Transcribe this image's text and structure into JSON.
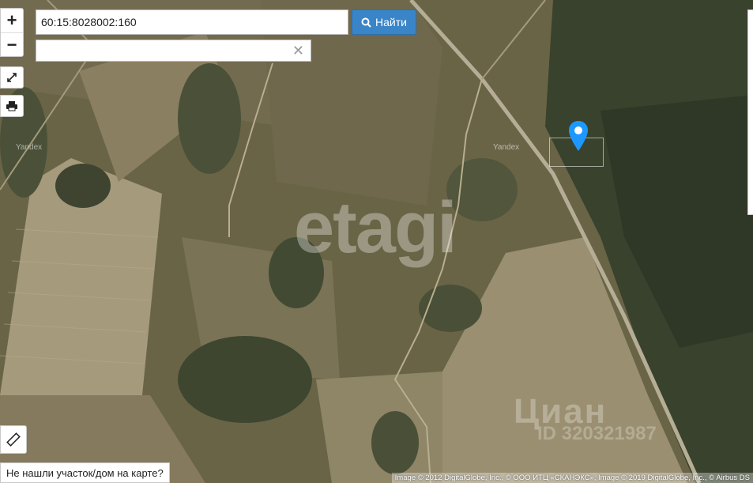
{
  "search": {
    "value": "60:15:8028002:160",
    "button_label": "Найти",
    "second_value": ""
  },
  "map": {
    "watermark": "etagi",
    "tile_labels": [
      "Yandex",
      "Yandex"
    ],
    "cian_watermark": "Циан",
    "cian_id": "ID 320321987",
    "attribution": "Image © 2012 DigitalGlobe, Inc., © ООО ИТЦ «СКАНЭКС», Image © 2019 DigitalGlobe, Inc., © Airbus DS"
  },
  "controls": {
    "zoom_in": "+",
    "zoom_out": "−",
    "not_found": "Не нашли участок/дом на карте?"
  },
  "colors": {
    "accent": "#3a84c8",
    "marker": "#1e98ff"
  }
}
